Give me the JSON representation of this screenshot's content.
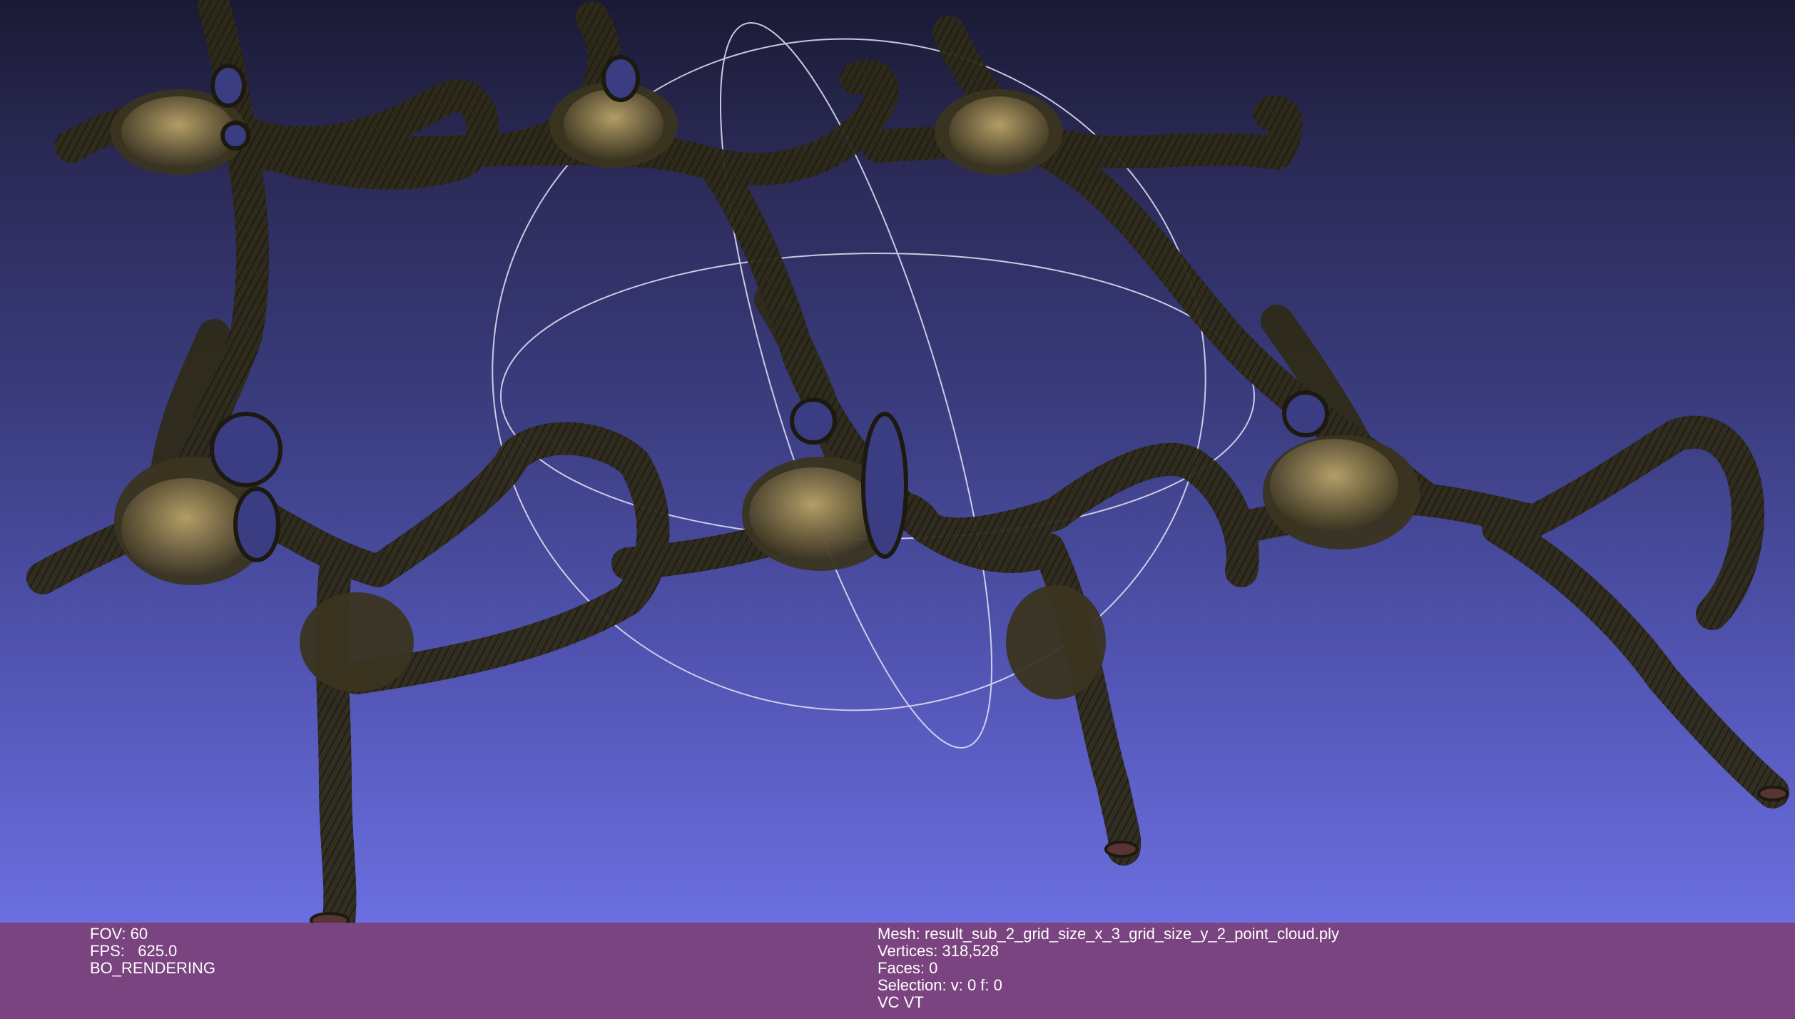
{
  "viewer": {
    "background_top": "#1a1a35",
    "background_bottom": "#6b6fe0",
    "mesh_color": "#3a3520",
    "mesh_highlight": "#b59f63",
    "trackball_color": "#d8d8ee"
  },
  "info_left": {
    "fov": "FOV: 60",
    "fps": "FPS:   625.0",
    "mode": "BO_RENDERING"
  },
  "info_right": {
    "mesh": "Mesh: result_sub_2_grid_size_x_3_grid_size_y_2_point_cloud.ply",
    "vertices": "Vertices: 318,528",
    "faces": "Faces: 0",
    "selection": "Selection: v: 0 f: 0",
    "flags": "VC VT"
  }
}
